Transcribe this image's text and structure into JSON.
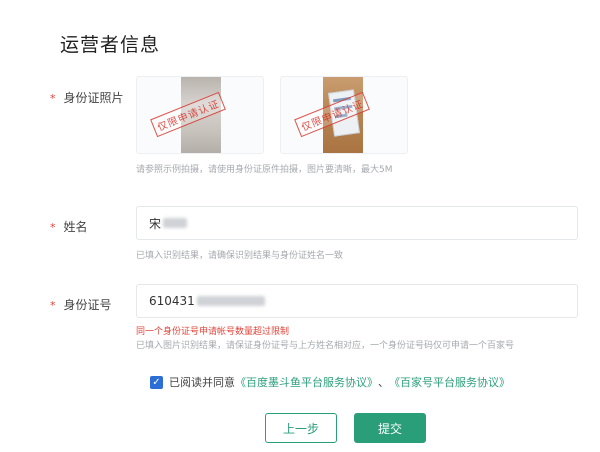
{
  "page": {
    "title": "运营者信息"
  },
  "id_photo": {
    "label": "身份证照片",
    "stamp_text": "仅限申请认证",
    "hint": "请参照示例拍摄，请使用身份证原件拍摄，图片要清晰，最大5M"
  },
  "name": {
    "label": "姓名",
    "value": "宋",
    "hint": "已填入识别结果，请确保识别结果与身份证姓名一致"
  },
  "id_number": {
    "label": "身份证号",
    "value": "610431",
    "error": "同一个身份证号申请帐号数量超过限制",
    "hint": "已填入图片识别结果，请保证身份证号与上方姓名相对应，一个身份证号码仅可申请一个百家号"
  },
  "agreement": {
    "checked": true,
    "prefix": "已阅读并同意",
    "link1": "《百度墨斗鱼平台服务协议》",
    "separator": "、",
    "link2": "《百家号平台服务协议》"
  },
  "buttons": {
    "prev": "上一步",
    "submit": "提交"
  },
  "required_mark": "*",
  "checkmark": "✓",
  "colors": {
    "primary": "#2a9d79",
    "error": "#e0443a",
    "checkbox": "#2b6fd6"
  }
}
